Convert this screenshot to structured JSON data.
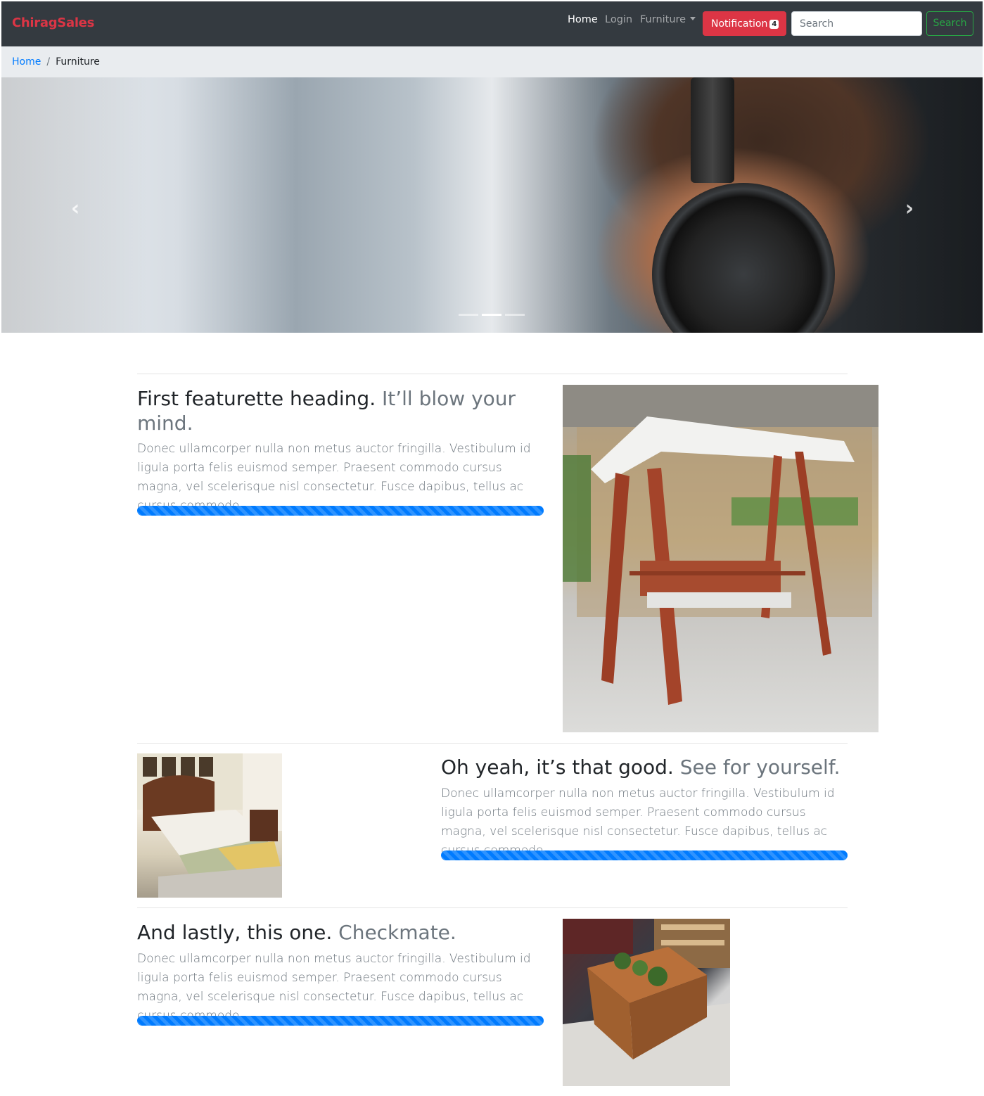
{
  "navbar": {
    "brand": "ChiragSales",
    "links": [
      {
        "label": "Home",
        "active": true
      },
      {
        "label": "Login",
        "active": false
      },
      {
        "label": "Furniture",
        "active": false,
        "dropdown": true
      }
    ],
    "notification": {
      "label": "Notification",
      "count": "4"
    },
    "search": {
      "placeholder": "Search",
      "button_label": "Search"
    }
  },
  "breadcrumb": {
    "items": [
      "Home",
      "Furniture"
    ],
    "separator": "/"
  },
  "carousel": {
    "prev_icon": "chevron-left-icon",
    "next_icon": "chevron-right-icon",
    "slide_count": 3,
    "active_index": 1
  },
  "featurettes": [
    {
      "heading": "First featurette heading.",
      "heading_muted": "It’ll blow your mind.",
      "lead": "Donec ullamcorper nulla non metus auctor fringilla. Vestibulum id ligula porta felis euismod semper. Praesent commodo cursus magna, vel scelerisque nisl consectetur. Fusce dapibus, tellus ac cursus commodo.",
      "progress": 100
    },
    {
      "heading": "Oh yeah, it’s that good.",
      "heading_muted": "See for yourself.",
      "lead": "Donec ullamcorper nulla non metus auctor fringilla. Vestibulum id ligula porta felis euismod semper. Praesent commodo cursus magna, vel scelerisque nisl consectetur. Fusce dapibus, tellus ac cursus commodo.",
      "progress": 100
    },
    {
      "heading": "And lastly, this one.",
      "heading_muted": "Checkmate.",
      "lead": "Donec ullamcorper nulla non metus auctor fringilla. Vestibulum id ligula porta felis euismod semper. Praesent commodo cursus magna, vel scelerisque nisl consectetur. Fusce dapibus, tellus ac cursus commodo.",
      "progress": 100
    }
  ],
  "colors": {
    "brand": "#dc3545",
    "navbar_bg": "#343a40",
    "primary": "#007bff",
    "success": "#28a745",
    "muted": "#6c757d"
  }
}
